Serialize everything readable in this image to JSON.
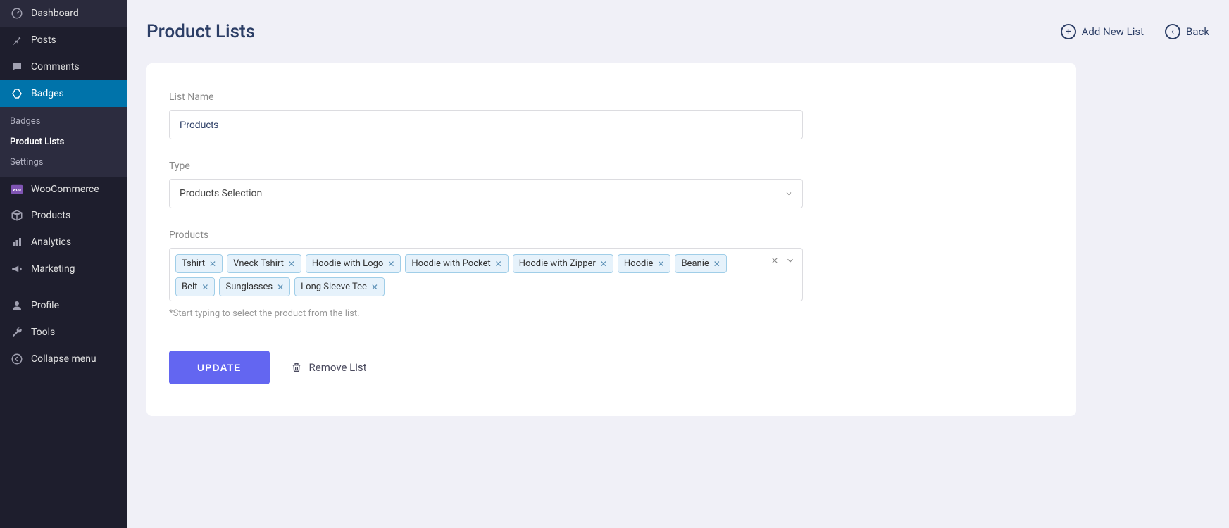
{
  "sidebar": {
    "items": [
      {
        "label": "Dashboard",
        "icon": "dashboard"
      },
      {
        "label": "Posts",
        "icon": "pin"
      },
      {
        "label": "Comments",
        "icon": "comment"
      },
      {
        "label": "Badges",
        "icon": "badge",
        "active": true
      },
      {
        "label": "WooCommerce",
        "icon": "woo"
      },
      {
        "label": "Products",
        "icon": "box"
      },
      {
        "label": "Analytics",
        "icon": "chart"
      },
      {
        "label": "Marketing",
        "icon": "megaphone"
      },
      {
        "label": "Profile",
        "icon": "user"
      },
      {
        "label": "Tools",
        "icon": "wrench"
      },
      {
        "label": "Collapse menu",
        "icon": "collapse"
      }
    ],
    "sub": [
      {
        "label": "Badges"
      },
      {
        "label": "Product Lists",
        "current": true
      },
      {
        "label": "Settings"
      }
    ]
  },
  "header": {
    "title": "Product Lists",
    "addNew": "Add New List",
    "back": "Back"
  },
  "form": {
    "listName": {
      "label": "List Name",
      "value": "Products"
    },
    "type": {
      "label": "Type",
      "value": "Products Selection"
    },
    "products": {
      "label": "Products",
      "tags": [
        "Tshirt",
        "Vneck Tshirt",
        "Hoodie with Logo",
        "Hoodie with Pocket",
        "Hoodie with Zipper",
        "Hoodie",
        "Beanie",
        "Belt",
        "Sunglasses",
        "Long Sleeve Tee"
      ],
      "hint": "*Start typing to select the product from the list."
    },
    "update": "UPDATE",
    "remove": "Remove List"
  }
}
